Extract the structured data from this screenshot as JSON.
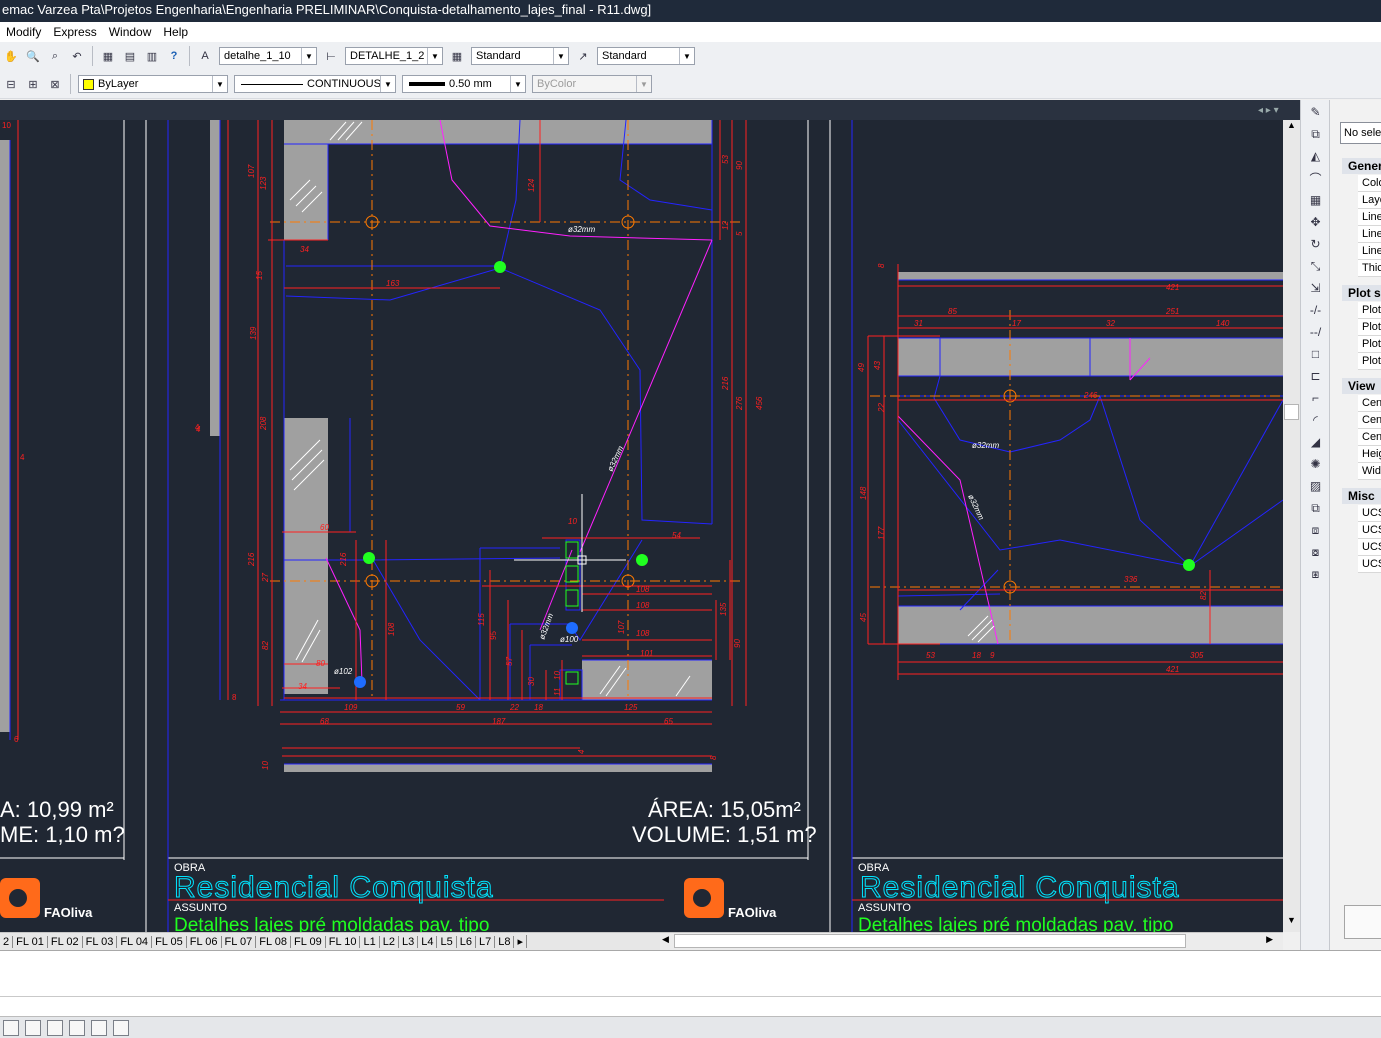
{
  "window": {
    "title": "emac Varzea Pta\\Projetos Engenharia\\Engenharia PRELIMINAR\\Conquista-detalhamento_lajes_final - R11.dwg]"
  },
  "menu": [
    "Modify",
    "Express",
    "Window",
    "Help"
  ],
  "toolbar1": {
    "text_style": "detalhe_1_10",
    "dim_style": "DETALHE_1_2",
    "table_style": "Standard",
    "mleader_style": "Standard"
  },
  "toolbar2": {
    "layer": "ByLayer",
    "linetype": "CONTINUOUS",
    "lineweight": "0.50 mm",
    "plotstyle": "ByColor"
  },
  "drawing": {
    "panel_left": {
      "area": "A:  10,99  m²",
      "volume": "ME:  1,10  m?",
      "logo": "FAOliva"
    },
    "panel_center": {
      "area": "ÁREA:  15,05m²",
      "volume": "VOLUME:  1,51  m?",
      "obra_label": "OBRA",
      "obra": "Residencial  Conquista",
      "assunto_label": "ASSUNTO",
      "assunto": "Detalhes  lajes  pré  moldadas  pav.  tipo",
      "logo": "FAOliva"
    },
    "panel_right": {
      "obra_label": "OBRA",
      "obra": "Residencial  Conquista",
      "assunto_label": "ASSUNTO",
      "assunto": "Detalhes  lajes  pré  moldadas  pav.  tipo"
    },
    "dims_center": [
      "34",
      "163",
      "124",
      "ø32mm",
      "12",
      "15",
      "25",
      "216",
      "276",
      "456",
      "139",
      "208",
      "ø32mm",
      "10",
      "60",
      "54",
      "216",
      "27",
      "82",
      "108",
      "115",
      "95",
      "57",
      "30",
      "11",
      "10",
      "108",
      "108",
      "108",
      "107",
      "90",
      "135",
      "101",
      "ø102",
      "ø100",
      "80",
      "34",
      "109",
      "59",
      "22",
      "18",
      "125",
      "68",
      "187",
      "65",
      "ø32mm",
      "4",
      "8",
      "10",
      "53",
      "90",
      "123",
      "107",
      "5"
    ],
    "dims_right": [
      "421",
      "85",
      "17",
      "32",
      "251",
      "31",
      "140",
      "43",
      "22",
      "246",
      "ø32mm",
      "ø32mm",
      "148",
      "177",
      "45",
      "336",
      "82",
      "53",
      "18",
      "9",
      "305",
      "421",
      "49"
    ]
  },
  "layout_tabs": [
    "2",
    "FL 01",
    "FL 02",
    "FL 03",
    "FL 04",
    "FL 05",
    "FL 06",
    "FL 07",
    "FL 08",
    "FL 09",
    "FL 10",
    "L1",
    "L2",
    "L3",
    "L4",
    "L5",
    "L6",
    "L7",
    "L8"
  ],
  "properties": {
    "selection": "No selec",
    "sections": [
      {
        "title": "Gener",
        "rows": [
          "Colo",
          "Laye",
          "Line",
          "Line",
          "Line",
          "Thic"
        ]
      },
      {
        "title": "Plot s",
        "rows": [
          "Plot",
          "Plot",
          "Plot",
          "Plot"
        ]
      },
      {
        "title": "View",
        "rows": [
          "Cen",
          "Cen",
          "Cen",
          "Heig",
          "Wid"
        ]
      },
      {
        "title": "Misc",
        "rows": [
          "UCS",
          "UCS",
          "UCS",
          "UCS"
        ]
      }
    ]
  },
  "colors": {
    "canvas": "#202733",
    "red": "#ff2020",
    "blue": "#2424ff",
    "magenta": "#ff20ff",
    "orange": "#ff7a00",
    "cyan": "#00e5ff",
    "green": "#20ff20",
    "gray": "#a0a0a0"
  }
}
